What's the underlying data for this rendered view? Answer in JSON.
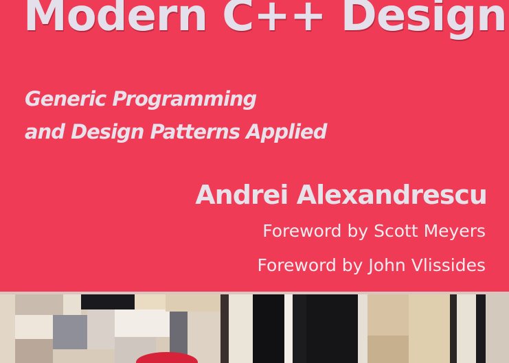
{
  "book": {
    "title": "Modern C++ Design",
    "subtitle_line1": "Generic Programming",
    "subtitle_line2": "and Design Patterns Applied",
    "author": "Andrei Alexandrescu",
    "foreword1": "Foreword by Scott Meyers",
    "foreword2": "Foreword by John Vlissides"
  },
  "colors": {
    "cover_red": "#ef3b55",
    "title_text": "#e3e0ec"
  }
}
